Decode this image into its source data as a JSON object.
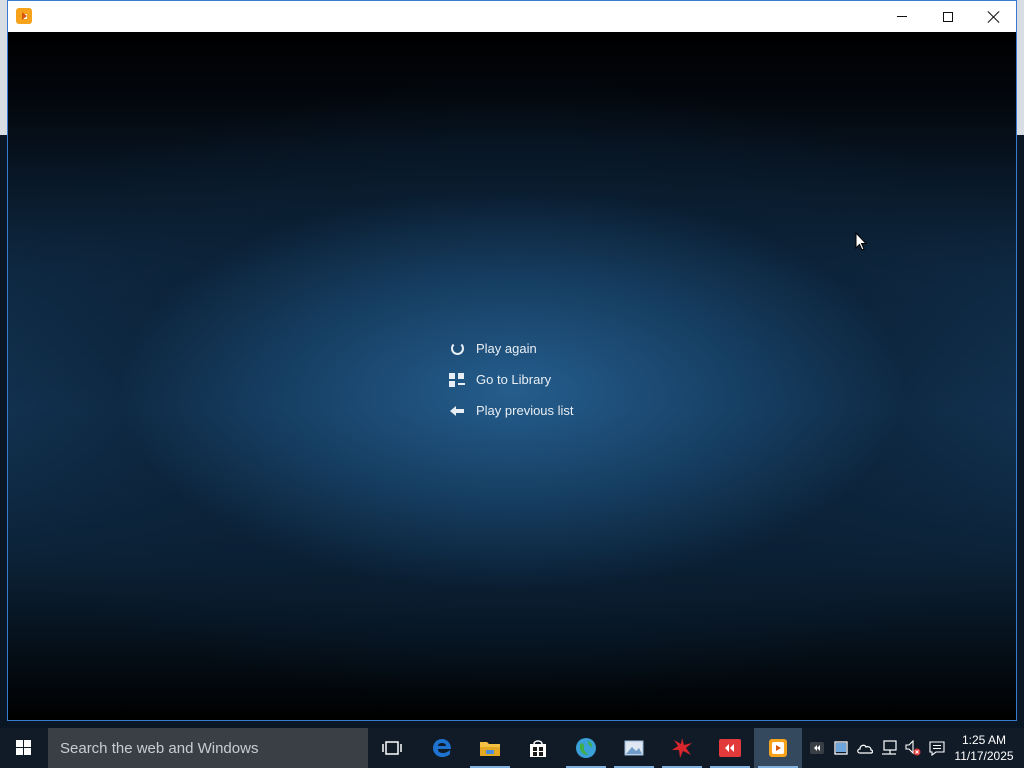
{
  "window": {
    "title": "",
    "accent_color": "#3a7bd0"
  },
  "player": {
    "menu": [
      {
        "icon": "replay-icon",
        "label": "Play again"
      },
      {
        "icon": "library-icon",
        "label": "Go to Library"
      },
      {
        "icon": "back-arrow-icon",
        "label": "Play previous list"
      }
    ]
  },
  "taskbar": {
    "search_placeholder": "Search the web and Windows",
    "apps": [
      {
        "icon": "task-view-icon"
      },
      {
        "icon": "edge-icon",
        "color": "#1e73d0"
      },
      {
        "icon": "file-explorer-icon",
        "color": "#f3c143"
      },
      {
        "icon": "store-icon",
        "color": "#ffffff"
      },
      {
        "icon": "browser-globe-icon",
        "color": "#3aa0d8"
      },
      {
        "icon": "image-viewer-icon",
        "color": "#9ab8d8"
      },
      {
        "icon": "red-app-icon",
        "color": "#d8262c"
      },
      {
        "icon": "red-media-app-icon",
        "color": "#e23a3a"
      },
      {
        "icon": "media-player-icon",
        "color": "#f6a21a"
      }
    ],
    "tray": [
      {
        "icon": "tray-app-icon"
      },
      {
        "icon": "tray-window-icon"
      },
      {
        "icon": "onedrive-icon"
      },
      {
        "icon": "network-icon"
      },
      {
        "icon": "volume-muted-icon"
      },
      {
        "icon": "action-center-icon"
      }
    ],
    "time": "1:25 AM",
    "date": "11/17/2025"
  }
}
